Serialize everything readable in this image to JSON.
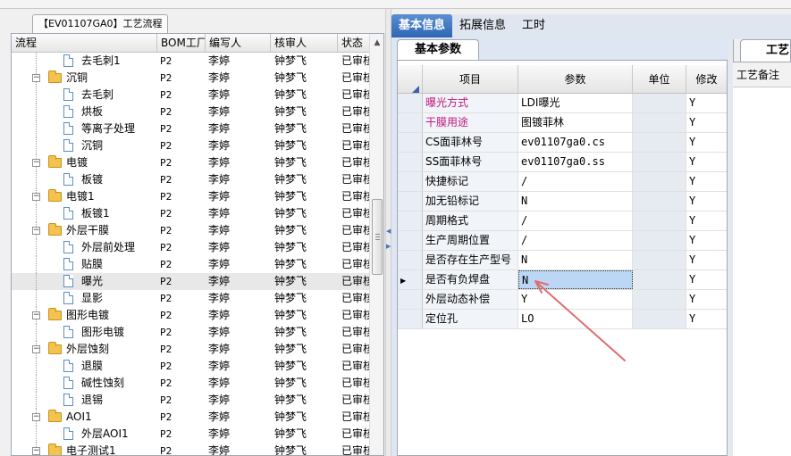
{
  "left_tab": {
    "label": "【EV01107GA0】工艺流程"
  },
  "tree": {
    "columns": [
      "流程",
      "BOM工厂",
      "编写人",
      "核审人",
      "状态"
    ],
    "rows": [
      {
        "level": 1,
        "type": "step",
        "name": "去毛刺1",
        "bom": "P2",
        "writer": "李婷",
        "reviewer": "钟梦飞",
        "status": "已审核",
        "selected": false
      },
      {
        "level": 0,
        "type": "folder",
        "name": "沉铜",
        "bom": "P2",
        "writer": "李婷",
        "reviewer": "钟梦飞",
        "status": "已审核",
        "selected": false
      },
      {
        "level": 1,
        "type": "step",
        "name": "去毛刺",
        "bom": "P2",
        "writer": "李婷",
        "reviewer": "钟梦飞",
        "status": "已审核",
        "selected": false
      },
      {
        "level": 1,
        "type": "step",
        "name": "烘板",
        "bom": "P2",
        "writer": "李婷",
        "reviewer": "钟梦飞",
        "status": "已审核",
        "selected": false
      },
      {
        "level": 1,
        "type": "step",
        "name": "等离子处理",
        "bom": "P2",
        "writer": "李婷",
        "reviewer": "钟梦飞",
        "status": "已审核",
        "selected": false
      },
      {
        "level": 1,
        "type": "step",
        "name": "沉铜",
        "bom": "P2",
        "writer": "李婷",
        "reviewer": "钟梦飞",
        "status": "已审核",
        "selected": false
      },
      {
        "level": 0,
        "type": "folder",
        "name": "电镀",
        "bom": "P2",
        "writer": "李婷",
        "reviewer": "钟梦飞",
        "status": "已审核",
        "selected": false
      },
      {
        "level": 1,
        "type": "step",
        "name": "板镀",
        "bom": "P2",
        "writer": "李婷",
        "reviewer": "钟梦飞",
        "status": "已审核",
        "selected": false
      },
      {
        "level": 0,
        "type": "folder",
        "name": "电镀1",
        "bom": "P2",
        "writer": "李婷",
        "reviewer": "钟梦飞",
        "status": "已审核",
        "selected": false
      },
      {
        "level": 1,
        "type": "step",
        "name": "板镀1",
        "bom": "P2",
        "writer": "李婷",
        "reviewer": "钟梦飞",
        "status": "已审核",
        "selected": false
      },
      {
        "level": 0,
        "type": "folder",
        "name": "外层干膜",
        "bom": "P2",
        "writer": "李婷",
        "reviewer": "钟梦飞",
        "status": "已审核",
        "selected": false
      },
      {
        "level": 1,
        "type": "step",
        "name": "外层前处理",
        "bom": "P2",
        "writer": "李婷",
        "reviewer": "钟梦飞",
        "status": "已审核",
        "selected": false
      },
      {
        "level": 1,
        "type": "step",
        "name": "贴膜",
        "bom": "P2",
        "writer": "李婷",
        "reviewer": "钟梦飞",
        "status": "已审核",
        "selected": false
      },
      {
        "level": 1,
        "type": "step",
        "name": "曝光",
        "bom": "P2",
        "writer": "李婷",
        "reviewer": "钟梦飞",
        "status": "已审核",
        "selected": true
      },
      {
        "level": 1,
        "type": "step",
        "name": "显影",
        "bom": "P2",
        "writer": "李婷",
        "reviewer": "钟梦飞",
        "status": "已审核",
        "selected": false
      },
      {
        "level": 0,
        "type": "folder",
        "name": "图形电镀",
        "bom": "P2",
        "writer": "李婷",
        "reviewer": "钟梦飞",
        "status": "已审核",
        "selected": false
      },
      {
        "level": 1,
        "type": "step",
        "name": "图形电镀",
        "bom": "P2",
        "writer": "李婷",
        "reviewer": "钟梦飞",
        "status": "已审核",
        "selected": false
      },
      {
        "level": 0,
        "type": "folder",
        "name": "外层蚀刻",
        "bom": "P2",
        "writer": "李婷",
        "reviewer": "钟梦飞",
        "status": "已审核",
        "selected": false
      },
      {
        "level": 1,
        "type": "step",
        "name": "退膜",
        "bom": "P2",
        "writer": "李婷",
        "reviewer": "钟梦飞",
        "status": "已审核",
        "selected": false
      },
      {
        "level": 1,
        "type": "step",
        "name": "碱性蚀刻",
        "bom": "P2",
        "writer": "李婷",
        "reviewer": "钟梦飞",
        "status": "已审核",
        "selected": false
      },
      {
        "level": 1,
        "type": "step",
        "name": "退锡",
        "bom": "P2",
        "writer": "李婷",
        "reviewer": "钟梦飞",
        "status": "已审核",
        "selected": false
      },
      {
        "level": 0,
        "type": "folder",
        "name": "AOI1",
        "bom": "P2",
        "writer": "李婷",
        "reviewer": "钟梦飞",
        "status": "已审核",
        "selected": false
      },
      {
        "level": 1,
        "type": "step",
        "name": "外层AOI1",
        "bom": "P2",
        "writer": "李婷",
        "reviewer": "钟梦飞",
        "status": "已审核",
        "selected": false
      },
      {
        "level": 0,
        "type": "folder",
        "name": "电子测试1",
        "bom": "P2",
        "writer": "李婷",
        "reviewer": "钟梦飞",
        "status": "已审核",
        "selected": false
      }
    ]
  },
  "right_tabs": [
    {
      "label": "基本信息",
      "active": true
    },
    {
      "label": "拓展信息",
      "active": false
    },
    {
      "label": "工时",
      "active": false
    }
  ],
  "sub_tab": {
    "label": "基本参数"
  },
  "grid": {
    "columns": [
      "项目",
      "参数",
      "单位",
      "修改"
    ],
    "rows": [
      {
        "item": "曝光方式",
        "value": "LDI曝光",
        "unit": "",
        "modify": "Y",
        "highlight": true,
        "current": false
      },
      {
        "item": "干膜用途",
        "value": "图镀菲林",
        "unit": "",
        "modify": "Y",
        "highlight": true,
        "current": false
      },
      {
        "item": "CS面菲林号",
        "value": "ev01107ga0.cs",
        "unit": "",
        "modify": "Y",
        "highlight": false,
        "current": false
      },
      {
        "item": "SS面菲林号",
        "value": "ev01107ga0.ss",
        "unit": "",
        "modify": "Y",
        "highlight": false,
        "current": false
      },
      {
        "item": "快捷标记",
        "value": "/",
        "unit": "",
        "modify": "Y",
        "highlight": false,
        "current": false
      },
      {
        "item": "加无铅标记",
        "value": "N",
        "unit": "",
        "modify": "Y",
        "highlight": false,
        "current": false
      },
      {
        "item": "周期格式",
        "value": "/",
        "unit": "",
        "modify": "Y",
        "highlight": false,
        "current": false
      },
      {
        "item": "生产周期位置",
        "value": "/",
        "unit": "",
        "modify": "Y",
        "highlight": false,
        "current": false
      },
      {
        "item": "是否存在生产型号",
        "value": "N",
        "unit": "",
        "modify": "Y",
        "highlight": false,
        "current": false
      },
      {
        "item": "是否有负焊盘",
        "value": "N",
        "unit": "",
        "modify": "Y",
        "highlight": false,
        "current": true
      },
      {
        "item": "外层动态补偿",
        "value": "Y",
        "unit": "",
        "modify": "Y",
        "highlight": false,
        "current": false
      },
      {
        "item": "定位孔",
        "value": "LO",
        "unit": "",
        "modify": "Y",
        "highlight": false,
        "current": false
      }
    ]
  },
  "right_sub": {
    "tab_label": "工艺",
    "column": "工艺备注"
  },
  "colors": {
    "highlight_item": "#c1197d",
    "active_tab": "#3a71bd",
    "annotation_arrow": "#e06c6c",
    "editing_cell": "#bcd7f5"
  }
}
